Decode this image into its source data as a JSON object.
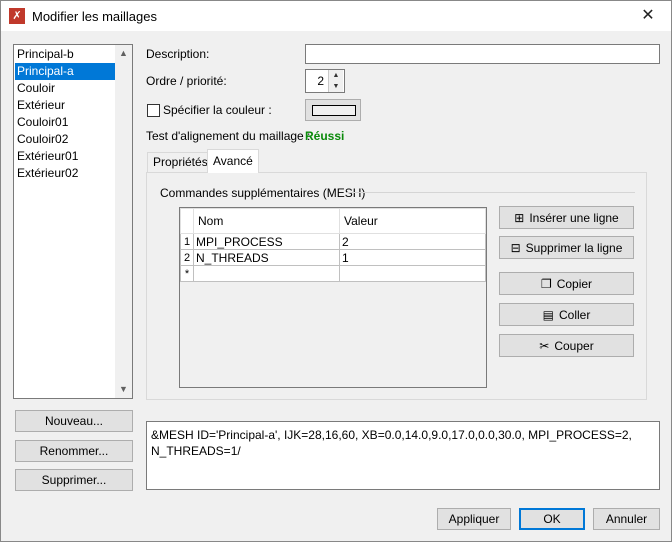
{
  "window": {
    "title": "Modifier les maillages"
  },
  "mesh_list": {
    "items": [
      "Principal-b",
      "Principal-a",
      "Couloir",
      "Extérieur",
      "Couloir01",
      "Couloir02",
      "Extérieur01",
      "Extérieur02"
    ],
    "selected_index": 1
  },
  "left_buttons": {
    "new": "Nouveau...",
    "rename": "Renommer...",
    "delete": "Supprimer..."
  },
  "form": {
    "description_label": "Description:",
    "description_value": "",
    "priority_label": "Ordre / priorité:",
    "priority_value": "2",
    "color_checkbox_label": "Spécifier la couleur :",
    "color_checked": false,
    "alignment_label": "Test d'alignement du maillage :",
    "alignment_status": "Réussi",
    "alignment_status_color": "#0a8a0a"
  },
  "tabs": [
    {
      "label": "Propriétés",
      "active": false
    },
    {
      "label": "Avancé",
      "active": true
    }
  ],
  "advanced": {
    "group_title": "Commandes supplémentaires (MESH)",
    "columns": [
      "Nom",
      "Valeur"
    ],
    "rows": [
      {
        "index": "1",
        "name": "MPI_PROCESS",
        "value": "2"
      },
      {
        "index": "2",
        "name": "N_THREADS",
        "value": "1"
      }
    ],
    "new_row_marker": "*",
    "buttons": {
      "insert": "Insérer une ligne",
      "delete_row": "Supprimer la ligne",
      "copy": "Copier",
      "paste": "Coller",
      "cut": "Couper"
    }
  },
  "output_text": "&MESH ID='Principal-a', IJK=28,16,60, XB=0.0,14.0,9.0,17.0,0.0,30.0, MPI_PROCESS=2, N_THREADS=1/",
  "footer_buttons": {
    "apply": "Appliquer",
    "ok": "OK",
    "cancel": "Annuler"
  },
  "colors": {
    "accent": "#0078d7",
    "button_bg": "#e1e1e1",
    "window_bg": "#f0f0f0"
  }
}
